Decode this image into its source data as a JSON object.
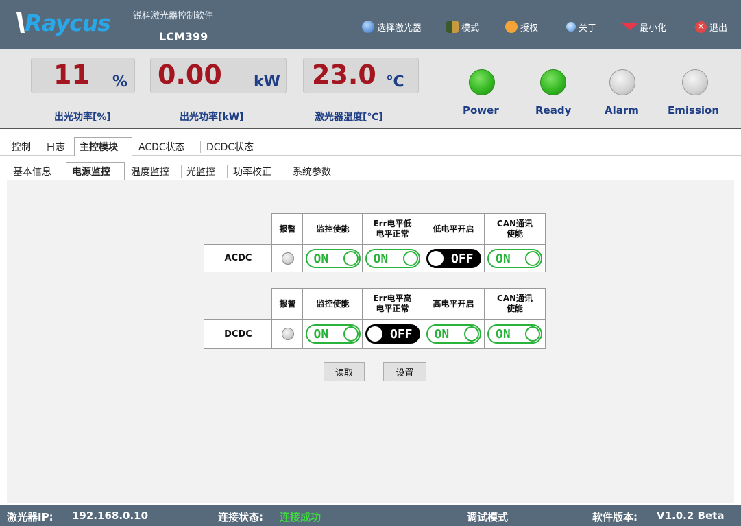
{
  "app": {
    "logo": "Raycus",
    "title": "锐科激光器控制软件",
    "model": "LCM399"
  },
  "menu": [
    {
      "label": "选择激光器",
      "icon": "globe-icon"
    },
    {
      "label": "模式",
      "icon": "users-icon"
    },
    {
      "label": "授权",
      "icon": "key-icon"
    },
    {
      "label": "关于",
      "icon": "info-icon"
    },
    {
      "label": "最小化",
      "icon": "minimize-icon"
    },
    {
      "label": "退出",
      "icon": "close-icon"
    }
  ],
  "meters": [
    {
      "value": "11",
      "unit": "%",
      "label": "出光功率[%]"
    },
    {
      "value": "0.00",
      "unit": "kW",
      "label": "出光功率[kW]"
    },
    {
      "value": "23.0",
      "unit": "℃",
      "label": "激光器温度[℃]"
    }
  ],
  "indicators": [
    {
      "label": "Power",
      "state": "on"
    },
    {
      "label": "Ready",
      "state": "on"
    },
    {
      "label": "Alarm",
      "state": "off"
    },
    {
      "label": "Emission",
      "state": "off"
    }
  ],
  "tabs_main": [
    "控制",
    "日志",
    "主控模块",
    "ACDC状态",
    "DCDC状态"
  ],
  "tabs_main_active": "主控模块",
  "tabs_sub": [
    "基本信息",
    "电源监控",
    "温度监控",
    "光监控",
    "功率校正",
    "系统参数"
  ],
  "tabs_sub_active": "电源监控",
  "acdc": {
    "name": "ACDC",
    "headers": [
      "报警",
      "监控使能",
      "Err电平低\n电平正常",
      "低电平开启",
      "CAN通讯\n使能"
    ],
    "toggles": [
      "ON",
      "ON",
      "OFF",
      "ON"
    ]
  },
  "dcdc": {
    "name": "DCDC",
    "headers": [
      "报警",
      "监控使能",
      "Err电平高\n电平正常",
      "高电平开启",
      "CAN通讯\n使能"
    ],
    "toggles": [
      "ON",
      "OFF",
      "ON",
      "ON"
    ]
  },
  "buttons": {
    "read": "读取",
    "set": "设置"
  },
  "status": {
    "ip_label": "激光器IP:",
    "ip_value": "192.168.0.10",
    "conn_label": "连接状态:",
    "conn_value": "连接成功",
    "mode": "调试模式",
    "version_label": "软件版本:",
    "version_value": "V1.0.2 Beta"
  },
  "colors": {
    "titlebar": "#566a7c",
    "meter_value": "#a31620",
    "label_blue": "#1e3e86",
    "toggle_on": "#2ab33a",
    "conn_ok": "#3fdc3f",
    "logo": "#2aa7e8"
  }
}
